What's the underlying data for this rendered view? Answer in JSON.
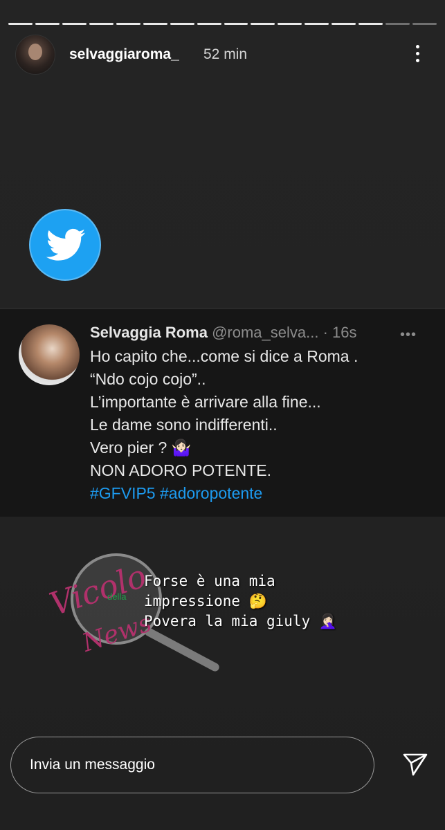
{
  "story": {
    "username": "selvaggiaroma_",
    "time": "52 min"
  },
  "tweet": {
    "name": "Selvaggia Roma",
    "handle": "@roma_selva...",
    "time": "· 16s",
    "more_dots": "•••",
    "lines": [
      "Ho capito che...come si dice a Roma .",
      "“Ndo cojo cojo”..",
      "L’importante è arrivare alla fine...",
      "Le dame sono indifferenti..",
      "Vero pier  ? 🤷🏻‍♀️",
      "NON ADORO POTENTE."
    ],
    "hashtags": "#GFVIP5 #adoropotente"
  },
  "sticker": {
    "watermark_word1": "Vicolo",
    "watermark_word2": "della",
    "watermark_word3": "News",
    "text_lines": [
      "Forse è una mia",
      "impressione 🤔",
      "Povera la mia giuly 🤦🏻‍♀️"
    ]
  },
  "composer": {
    "placeholder": "Invia un messaggio"
  }
}
